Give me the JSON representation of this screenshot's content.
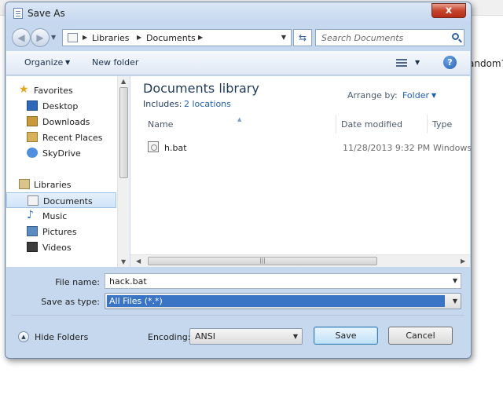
{
  "background": {
    "visible_text": "andom?"
  },
  "dialog": {
    "title": "Save As",
    "close_label": "x"
  },
  "address_bar": {
    "crumbs": [
      "Libraries",
      "Documents"
    ],
    "search_placeholder": "Search Documents"
  },
  "toolbar": {
    "organize_label": "Organize",
    "new_folder_label": "New folder",
    "help_label": "?"
  },
  "nav": {
    "favorites_label": "Favorites",
    "favorites": [
      {
        "label": "Desktop",
        "icon": "desktop-icon"
      },
      {
        "label": "Downloads",
        "icon": "downloads-folder-icon"
      },
      {
        "label": "Recent Places",
        "icon": "recent-places-icon"
      },
      {
        "label": "SkyDrive",
        "icon": "skydrive-icon"
      }
    ],
    "libraries_label": "Libraries",
    "libraries": [
      {
        "label": "Documents",
        "icon": "documents-library-icon",
        "selected": true
      },
      {
        "label": "Music",
        "icon": "music-library-icon"
      },
      {
        "label": "Pictures",
        "icon": "pictures-library-icon"
      },
      {
        "label": "Videos",
        "icon": "videos-library-icon"
      }
    ]
  },
  "content": {
    "library_title": "Documents library",
    "includes_label": "Includes:",
    "includes_link": "2 locations",
    "arrange_label": "Arrange by:",
    "arrange_value": "Folder",
    "columns": [
      "Name",
      "Date modified",
      "Type"
    ],
    "files": [
      {
        "name": "h.bat",
        "date_modified": "11/28/2013 9:32 PM",
        "type": "Windows"
      }
    ]
  },
  "form": {
    "file_name_label": "File name:",
    "file_name_value": "hack.bat",
    "save_type_label": "Save as type:",
    "save_type_value": "All Files  (*.*)",
    "encoding_label": "Encoding:",
    "encoding_value": "ANSI"
  },
  "footer": {
    "hide_folders_label": "Hide Folders",
    "save_label": "Save",
    "cancel_label": "Cancel"
  },
  "colors": {
    "dialog_frame": "#c6d8ee",
    "title_text": "#1e395b",
    "link": "#1a5fb4",
    "selection": "#3a74c5",
    "close_button": "#c7432b"
  }
}
